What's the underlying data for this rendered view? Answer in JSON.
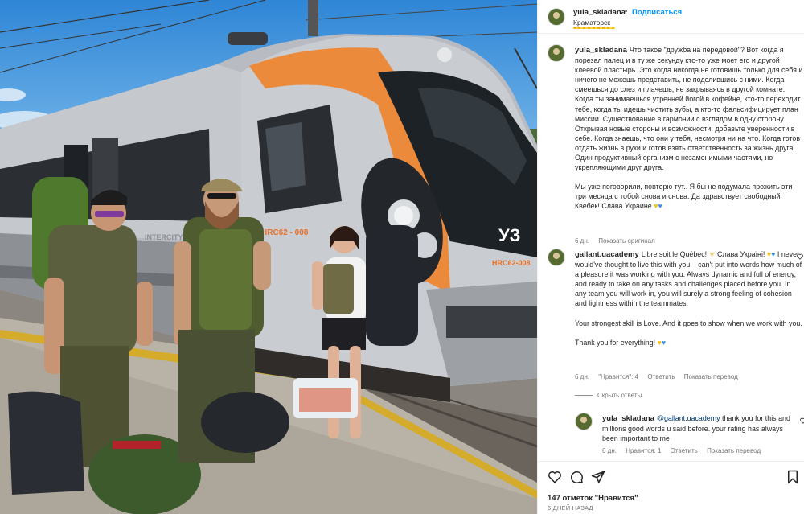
{
  "post": {
    "author": "yula_skladana",
    "follow_label": "Подписаться",
    "location": "Краматорск",
    "colors": {
      "link": "#0095f6",
      "text": "#262626",
      "muted": "#737373",
      "yellow_heart": "#f4c20d",
      "blue_heart": "#3b8ee8"
    }
  },
  "photo": {
    "train_logo": "УЗ",
    "train_number_1": "HRC62 - 008",
    "train_number_2": "HRC62-008",
    "train_side_text": "INTERCITY"
  },
  "caption": {
    "username": "yula_skladana",
    "text_1": "Что такое \"дружба на передовой\"? Вот когда я порезал палец и в ту же секунду кто-то уже моет его и другой клеевой пластырь. Это когда никогда не готовишь только для себя и ничего не можешь представить, не поделившись с ними. Когда смеешься до слез и плачешь, не закрываясь в другой комнате. Когда ты занимаешься утренней йогой в кофейне, кто-то переходит тебе, когда ты идешь чистить зубы, а кто-то фальсифицирует план миссии. Существование в гармонии с взглядом в одну сторону. Открывая новые стороны и возможности, добавьте уверенности в себе. Когда знаешь, что они у тебя, несмотря ни на что. Когда готов отдать жизнь в руки и готов взять ответственность за жизнь друга. Один продуктивный организм с незаменимыми частями, но укрепляющими друг друга.",
    "text_2": "Мы уже поговорили, повторю тут.. Я бы не подумала прожить эти три месяца с тобой снова и снова. Да здравствует свободный Квебек! Слава Украине",
    "time": "6 дн.",
    "show_original": "Показать оригинал"
  },
  "comment_1": {
    "username": "gallant.uacademy",
    "text_a": "Libre soit le Québec!",
    "text_b": "Слава Україні!",
    "text_c": "I never would've thought to live this with you. I can't put into words how much of a pleasure it was working with you. Always dynamic and full of energy, and ready to take on any tasks and challenges placed before you. In any team you will work in, you will surely a strong feeling of cohesion and lightness within the teammates.",
    "text_d": "Your strongest skill is Love. And it goes to show when we work with you.",
    "text_e": "Thank you for everything!",
    "time": "6 дн.",
    "likes": "\"Нравится\": 4",
    "reply": "Ответить",
    "translate": "Показать перевод",
    "hide_replies": "Скрыть ответы"
  },
  "reply_1": {
    "username": "yula_skladana",
    "mention": "@gallant.uacademy",
    "text": "thank you for this and millions good words u said before. your rating has always been important to me",
    "time": "6 дн.",
    "likes": "Нравится: 1",
    "reply": "Ответить",
    "translate": "Показать перевод"
  },
  "footer": {
    "likes": "147 отметок \"Нравится\"",
    "ago": "6 ДНЕЙ НАЗАД"
  },
  "icons": [
    "heart-icon",
    "comment-icon",
    "share-icon",
    "bookmark-icon",
    "like-comment-icon"
  ]
}
